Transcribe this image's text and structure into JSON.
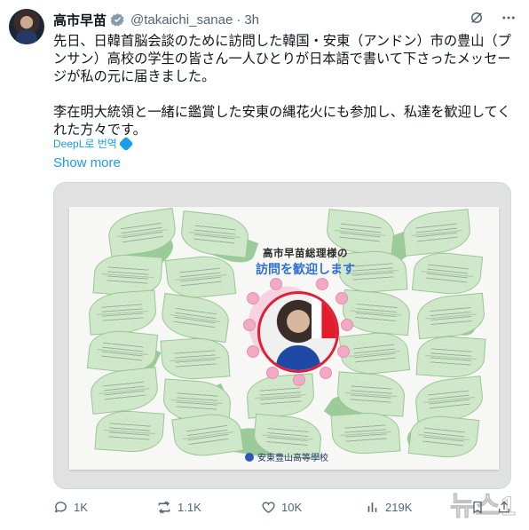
{
  "author": {
    "name": "高市早苗",
    "handle": "@takaichi_sanae",
    "separator": "·",
    "time": "3h"
  },
  "post": {
    "paragraph1": "先日、日韓首脳会談のために訪問した韓国・安東（アンドン）市の豊山（プンサン）高校の学生の皆さん一人ひとりが日本語で書いて下さったメッセージが私の元に届きました。",
    "paragraph2": "李在明大統領と一緒に鑑賞した安東の縄花火にも参加し、私達を歓迎してくれた方々です。",
    "translate_label": "DeepL로 번역",
    "show_more_label": "Show more"
  },
  "media": {
    "banner_line1": "高市早苗総理様の",
    "banner_line2": "訪問を歓迎します",
    "school_name": "安東豊山高等學校"
  },
  "actions": {
    "replies": "1K",
    "reposts": "1.1K",
    "likes": "10K",
    "views": "219K"
  },
  "watermark": "뉴스1",
  "colors": {
    "accent": "#1d9bf0",
    "muted": "#536471",
    "verified": "#829aab"
  }
}
